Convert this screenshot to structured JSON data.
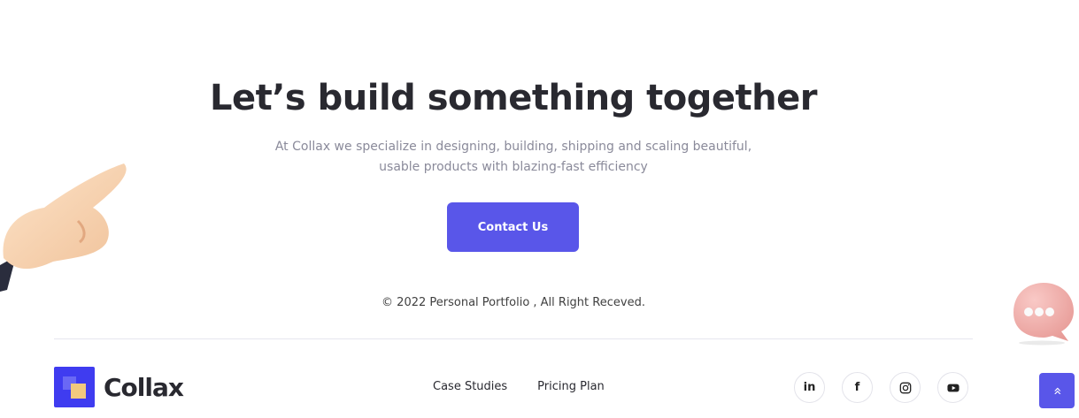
{
  "hero": {
    "title": "Let’s build something together",
    "subtitle_line1": "At Collax we specialize in designing, building, shipping and scaling beautiful,",
    "subtitle_line2": "usable products with blazing-fast efficiency",
    "cta_label": "Contact Us"
  },
  "copyright": "© 2022 Personal Portfolio , All Right Receved.",
  "footer": {
    "logo_text": "Collax",
    "nav": [
      {
        "label": "Case Studies"
      },
      {
        "label": "Pricing Plan"
      }
    ],
    "socials": [
      {
        "icon": "linkedin-icon",
        "glyph": "in"
      },
      {
        "icon": "facebook-icon",
        "glyph": "f"
      },
      {
        "icon": "instagram-icon"
      },
      {
        "icon": "youtube-icon"
      }
    ]
  },
  "colors": {
    "accent": "#5956e9",
    "heading": "#292930",
    "muted": "#8a8a9a"
  }
}
